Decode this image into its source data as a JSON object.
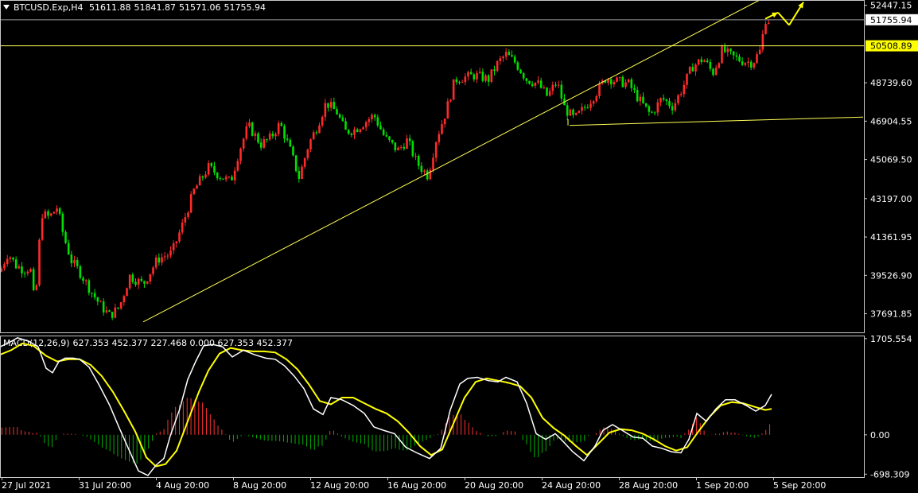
{
  "header": {
    "symbol": "BTCUSD.Exp,H4",
    "open": "51611.88",
    "high": "51841.87",
    "low": "51571.06",
    "close": "51755.94"
  },
  "macd_header": {
    "name": "MACD(12,26,9)",
    "values": "627.353 452.377 227.468 0.000 627.353 452.377"
  },
  "colors": {
    "background": "#000000",
    "bull": "#ff2a2a",
    "bear": "#00e000",
    "trendline": "#ffff55",
    "macd_main": "#ffffff",
    "macd_signal": "#ffff00",
    "price_tag_bg": "#ffff00"
  },
  "chart_data": [
    {
      "type": "candlestick",
      "ylim": [
        36800,
        52700
      ],
      "y_ticks": [
        "52447.15",
        "48739.60",
        "46904.55",
        "45069.50",
        "43197.00",
        "41361.95",
        "39526.90",
        "37691.85"
      ],
      "x_ticks": [
        "27 Jul 2021",
        "31 Jul 20:00",
        "4 Aug 20:00",
        "8 Aug 20:00",
        "12 Aug 20:00",
        "16 Aug 20:00",
        "20 Aug 20:00",
        "24 Aug 20:00",
        "28 Aug 20:00",
        "1 Sep 20:00",
        "5 Sep 20:00"
      ],
      "current_price": "51755.94",
      "resistance_level": "50508.89",
      "candle_count": 264,
      "close_path": [
        [
          0,
          39700
        ],
        [
          10,
          40600
        ],
        [
          20,
          40000
        ],
        [
          30,
          39800
        ],
        [
          38,
          39900
        ],
        [
          44,
          38000
        ],
        [
          52,
          42500
        ],
        [
          62,
          42300
        ],
        [
          72,
          42800
        ],
        [
          80,
          41400
        ],
        [
          90,
          40200
        ],
        [
          100,
          39700
        ],
        [
          114,
          38800
        ],
        [
          126,
          38100
        ],
        [
          138,
          37600
        ],
        [
          150,
          38000
        ],
        [
          163,
          39500
        ],
        [
          180,
          39100
        ],
        [
          198,
          40300
        ],
        [
          216,
          40600
        ],
        [
          228,
          41800
        ],
        [
          244,
          43600
        ],
        [
          262,
          44700
        ],
        [
          276,
          44300
        ],
        [
          290,
          44000
        ],
        [
          300,
          45400
        ],
        [
          312,
          46700
        ],
        [
          328,
          45800
        ],
        [
          340,
          46100
        ],
        [
          352,
          46800
        ],
        [
          364,
          45600
        ],
        [
          376,
          44200
        ],
        [
          388,
          45800
        ],
        [
          398,
          46600
        ],
        [
          410,
          47800
        ],
        [
          424,
          47300
        ],
        [
          434,
          46400
        ],
        [
          446,
          46500
        ],
        [
          460,
          46900
        ],
        [
          470,
          47200
        ],
        [
          484,
          46100
        ],
        [
          500,
          45500
        ],
        [
          512,
          46000
        ],
        [
          524,
          44900
        ],
        [
          538,
          44300
        ],
        [
          548,
          46000
        ],
        [
          560,
          47300
        ],
        [
          572,
          48900
        ],
        [
          584,
          49000
        ],
        [
          598,
          49100
        ],
        [
          614,
          48900
        ],
        [
          626,
          49700
        ],
        [
          636,
          50100
        ],
        [
          648,
          49700
        ],
        [
          662,
          48900
        ],
        [
          676,
          48700
        ],
        [
          688,
          48100
        ],
        [
          700,
          48800
        ],
        [
          710,
          47500
        ],
        [
          722,
          47000
        ],
        [
          736,
          47600
        ],
        [
          750,
          48300
        ],
        [
          762,
          49000
        ],
        [
          776,
          48800
        ],
        [
          790,
          48700
        ],
        [
          804,
          47900
        ],
        [
          818,
          47200
        ],
        [
          832,
          48000
        ],
        [
          846,
          47600
        ],
        [
          858,
          48500
        ],
        [
          870,
          49500
        ],
        [
          884,
          49900
        ],
        [
          896,
          49200
        ],
        [
          908,
          50300
        ],
        [
          920,
          50000
        ],
        [
          932,
          49800
        ],
        [
          946,
          49700
        ],
        [
          956,
          50300
        ],
        [
          962,
          51800
        ],
        [
          968,
          51700
        ]
      ],
      "forecast_arrows": [
        [
          962,
          51800,
          978,
          52100
        ],
        [
          978,
          52100,
          992,
          51500
        ],
        [
          992,
          51500,
          1010,
          52600
        ]
      ],
      "trendlines": [
        {
          "from": [
            180,
            37300
          ],
          "to": [
            955,
            52700
          ]
        },
        {
          "from": [
            716,
            46700
          ],
          "to": [
            1085,
            47100
          ]
        },
        {
          "from": [
            714,
            46700
          ],
          "to": [
            714,
            47000
          ]
        }
      ]
    },
    {
      "type": "macd",
      "name": "MACD(12,26,9)",
      "ylim": [
        -750,
        1760
      ],
      "y_ticks": [
        "1705.554",
        "0.00",
        "-698.309"
      ],
      "main_path": [
        [
          0,
          1560
        ],
        [
          12,
          1640
        ],
        [
          22,
          1720
        ],
        [
          36,
          1660
        ],
        [
          48,
          1560
        ],
        [
          58,
          1180
        ],
        [
          66,
          1100
        ],
        [
          74,
          1300
        ],
        [
          82,
          1360
        ],
        [
          92,
          1360
        ],
        [
          100,
          1340
        ],
        [
          112,
          1200
        ],
        [
          124,
          900
        ],
        [
          138,
          520
        ],
        [
          150,
          120
        ],
        [
          162,
          -260
        ],
        [
          174,
          -640
        ],
        [
          186,
          -720
        ],
        [
          196,
          -540
        ],
        [
          206,
          -420
        ],
        [
          214,
          -20
        ],
        [
          226,
          460
        ],
        [
          236,
          980
        ],
        [
          246,
          1300
        ],
        [
          256,
          1580
        ],
        [
          268,
          1600
        ],
        [
          280,
          1560
        ],
        [
          292,
          1380
        ],
        [
          306,
          1500
        ],
        [
          320,
          1420
        ],
        [
          334,
          1360
        ],
        [
          346,
          1340
        ],
        [
          358,
          1220
        ],
        [
          370,
          1040
        ],
        [
          382,
          820
        ],
        [
          394,
          460
        ],
        [
          406,
          360
        ],
        [
          416,
          660
        ],
        [
          430,
          620
        ],
        [
          444,
          520
        ],
        [
          458,
          380
        ],
        [
          470,
          140
        ],
        [
          482,
          80
        ],
        [
          496,
          20
        ],
        [
          510,
          -220
        ],
        [
          524,
          -320
        ],
        [
          540,
          -420
        ],
        [
          554,
          -240
        ],
        [
          566,
          440
        ],
        [
          578,
          900
        ],
        [
          588,
          1000
        ],
        [
          600,
          1020
        ],
        [
          614,
          960
        ],
        [
          626,
          940
        ],
        [
          636,
          1020
        ],
        [
          650,
          940
        ],
        [
          662,
          560
        ],
        [
          674,
          20
        ],
        [
          686,
          -80
        ],
        [
          698,
          20
        ],
        [
          708,
          -120
        ],
        [
          720,
          -300
        ],
        [
          734,
          -460
        ],
        [
          748,
          -200
        ],
        [
          758,
          80
        ],
        [
          770,
          180
        ],
        [
          782,
          80
        ],
        [
          796,
          -40
        ],
        [
          808,
          -60
        ],
        [
          820,
          -200
        ],
        [
          832,
          -240
        ],
        [
          844,
          -300
        ],
        [
          856,
          -320
        ],
        [
          866,
          -80
        ],
        [
          876,
          380
        ],
        [
          888,
          240
        ],
        [
          900,
          460
        ],
        [
          912,
          620
        ],
        [
          924,
          620
        ],
        [
          938,
          520
        ],
        [
          950,
          420
        ],
        [
          962,
          520
        ],
        [
          970,
          720
        ]
      ],
      "signal_path": [
        [
          0,
          1420
        ],
        [
          14,
          1500
        ],
        [
          28,
          1620
        ],
        [
          42,
          1580
        ],
        [
          58,
          1400
        ],
        [
          72,
          1300
        ],
        [
          86,
          1340
        ],
        [
          100,
          1340
        ],
        [
          114,
          1240
        ],
        [
          128,
          1040
        ],
        [
          142,
          760
        ],
        [
          156,
          420
        ],
        [
          170,
          60
        ],
        [
          184,
          -400
        ],
        [
          196,
          -560
        ],
        [
          208,
          -520
        ],
        [
          222,
          -280
        ],
        [
          236,
          240
        ],
        [
          250,
          760
        ],
        [
          262,
          1140
        ],
        [
          276,
          1440
        ],
        [
          290,
          1540
        ],
        [
          304,
          1500
        ],
        [
          318,
          1480
        ],
        [
          332,
          1480
        ],
        [
          346,
          1460
        ],
        [
          360,
          1340
        ],
        [
          374,
          1160
        ],
        [
          388,
          900
        ],
        [
          402,
          600
        ],
        [
          416,
          540
        ],
        [
          430,
          660
        ],
        [
          444,
          660
        ],
        [
          458,
          560
        ],
        [
          472,
          460
        ],
        [
          486,
          380
        ],
        [
          500,
          240
        ],
        [
          514,
          40
        ],
        [
          528,
          -200
        ],
        [
          542,
          -360
        ],
        [
          556,
          -260
        ],
        [
          570,
          200
        ],
        [
          584,
          660
        ],
        [
          598,
          940
        ],
        [
          612,
          1000
        ],
        [
          626,
          960
        ],
        [
          640,
          920
        ],
        [
          654,
          860
        ],
        [
          668,
          660
        ],
        [
          682,
          300
        ],
        [
          696,
          120
        ],
        [
          710,
          -20
        ],
        [
          724,
          -200
        ],
        [
          738,
          -360
        ],
        [
          752,
          -160
        ],
        [
          766,
          40
        ],
        [
          780,
          100
        ],
        [
          794,
          80
        ],
        [
          808,
          20
        ],
        [
          822,
          -80
        ],
        [
          836,
          -200
        ],
        [
          850,
          -280
        ],
        [
          864,
          -220
        ],
        [
          878,
          60
        ],
        [
          892,
          320
        ],
        [
          906,
          520
        ],
        [
          920,
          580
        ],
        [
          934,
          560
        ],
        [
          948,
          500
        ],
        [
          962,
          440
        ],
        [
          970,
          460
        ]
      ]
    }
  ]
}
